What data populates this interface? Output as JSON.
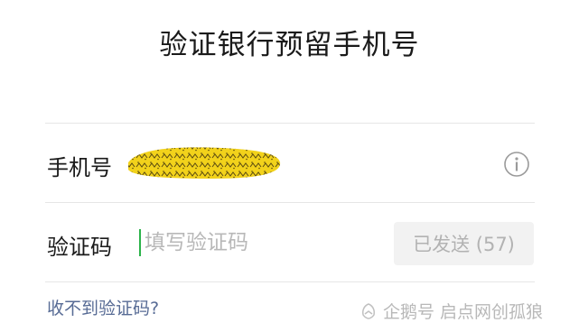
{
  "page": {
    "title": "验证银行预留手机号"
  },
  "phone_row": {
    "label": "手机号",
    "value_redacted": true
  },
  "code_row": {
    "label": "验证码",
    "placeholder": "填写验证码",
    "value": "",
    "resend_button_label": "已发送 (57)"
  },
  "help_link": {
    "label": "收不到验证码?"
  },
  "watermark": {
    "text": "企鹅号 启点网创孤狼"
  },
  "icons": {
    "info": "info-circle-icon",
    "watermark_logo": "penguin-logo-icon"
  },
  "colors": {
    "cursor": "#2bb34a",
    "link": "#576b95",
    "redaction": "#f2d21b"
  }
}
